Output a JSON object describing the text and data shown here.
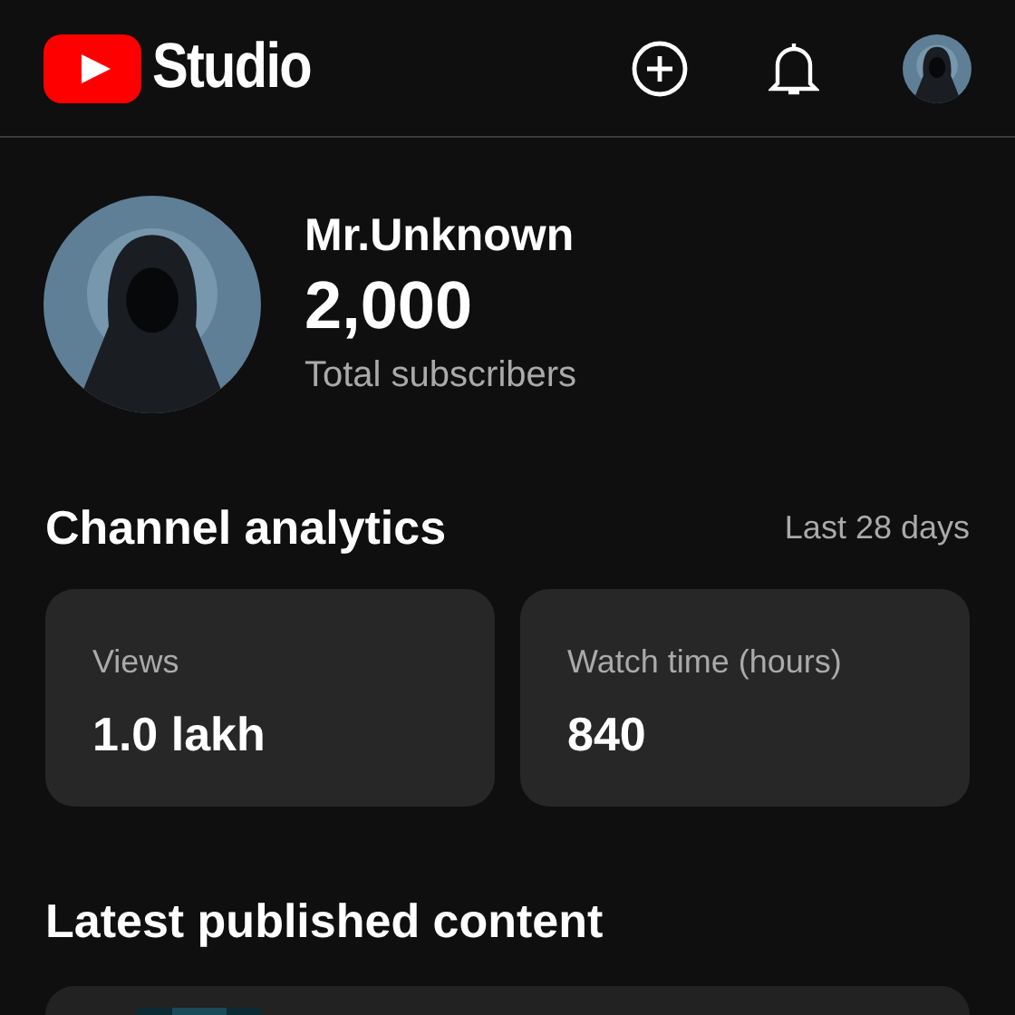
{
  "header": {
    "logo_text": "Studio"
  },
  "channel": {
    "name": "Mr.Unknown",
    "subscribers": "2,000",
    "subscribers_label": "Total subscribers"
  },
  "analytics": {
    "title": "Channel analytics",
    "period": "Last 28 days",
    "cards": [
      {
        "label": "Views",
        "value": "1.0 lakh"
      },
      {
        "label": "Watch time (hours)",
        "value": "840"
      }
    ]
  },
  "latest": {
    "title": "Latest published content"
  }
}
